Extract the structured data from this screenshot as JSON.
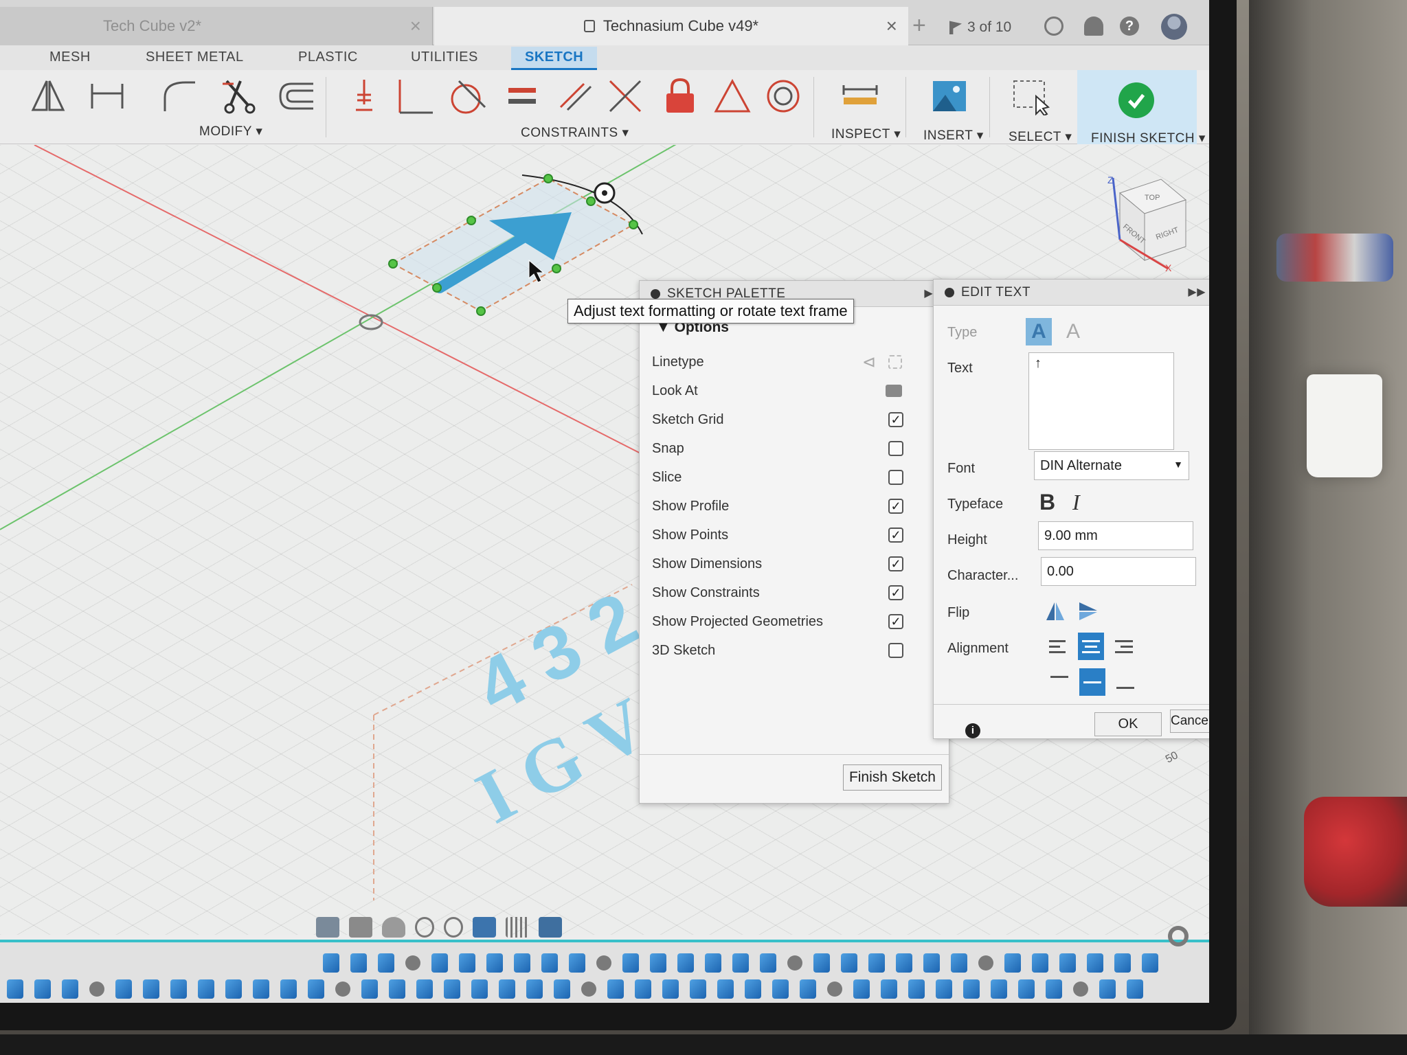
{
  "tabs": {
    "inactive_title": "Tech Cube v2*",
    "active_title": "Technasium Cube v49*",
    "jobs": "3 of 10"
  },
  "menu_tabs": [
    "MESH",
    "SHEET METAL",
    "PLASTIC",
    "UTILITIES",
    "SKETCH"
  ],
  "toolbar": {
    "modify_label": "MODIFY ▾",
    "constraints_label": "CONSTRAINTS ▾",
    "inspect_label": "INSPECT ▾",
    "insert_label": "INSERT ▾",
    "select_label": "SELECT ▾",
    "finish_label": "FINISH SKETCH ▾"
  },
  "canvas": {
    "engraved_text_1": "4 3 2",
    "engraved_text_2": "I G V",
    "view_cube": {
      "top": "TOP",
      "front": "FRONT",
      "right": "RIGHT",
      "z": "Z",
      "x": "X"
    },
    "dimension": "50"
  },
  "tooltip": "Adjust text formatting or rotate text frame",
  "sketch_palette": {
    "title": "SKETCH PALETTE",
    "options_header": "Options",
    "rows": [
      {
        "label": "Linetype",
        "control": "icons"
      },
      {
        "label": "Look At",
        "control": "icon"
      },
      {
        "label": "Sketch Grid",
        "checked": true
      },
      {
        "label": "Snap",
        "checked": false
      },
      {
        "label": "Slice",
        "checked": false
      },
      {
        "label": "Show Profile",
        "checked": true
      },
      {
        "label": "Show Points",
        "checked": true
      },
      {
        "label": "Show Dimensions",
        "checked": true
      },
      {
        "label": "Show Constraints",
        "checked": true
      },
      {
        "label": "Show Projected Geometries",
        "checked": true
      },
      {
        "label": "3D Sketch",
        "checked": false
      }
    ],
    "finish_button": "Finish Sketch"
  },
  "edit_text": {
    "title": "EDIT TEXT",
    "type_label": "Type",
    "text_label": "Text",
    "text_value": "↑",
    "font_label": "Font",
    "font_value": "DIN Alternate",
    "typeface_label": "Typeface",
    "bold": "B",
    "italic": "I",
    "height_label": "Height",
    "height_value": "9.00 mm",
    "character_label": "Character...",
    "character_value": "0.00",
    "flip_label": "Flip",
    "alignment_label": "Alignment",
    "ok": "OK",
    "cancel": "Cancel"
  },
  "colors": {
    "accent": "#1976c3",
    "finish_check": "#21a54a",
    "timeline": "#38c0c9",
    "sketch_text": "#6fb9de"
  }
}
